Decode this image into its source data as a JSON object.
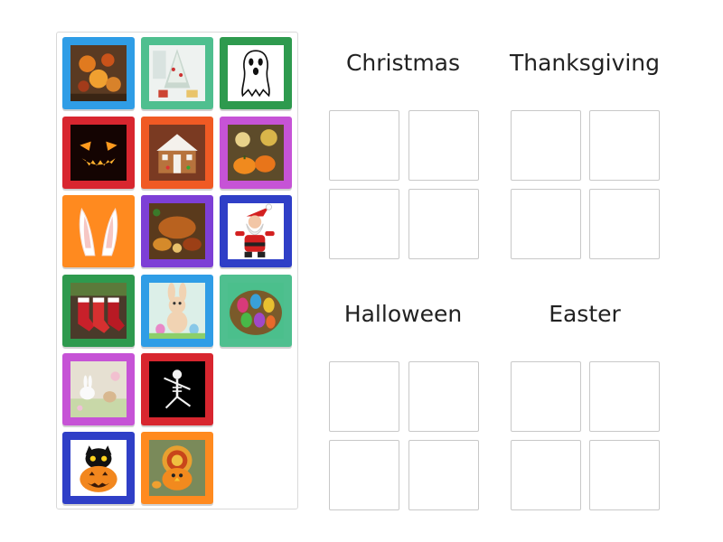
{
  "groups": [
    {
      "title": "Christmas"
    },
    {
      "title": "Thanksgiving"
    },
    {
      "title": "Halloween"
    },
    {
      "title": "Easter"
    }
  ],
  "tiles": [
    {
      "name": "tile-autumn-harvest",
      "frame": "#2f9de6",
      "picture": "harvest-table-icon"
    },
    {
      "name": "tile-christmas-tree-room",
      "frame": "#4fbf8f",
      "picture": "christmas-tree-icon"
    },
    {
      "name": "tile-ghost-drawing",
      "frame": "#2e9a4e",
      "picture": "ghost-icon"
    },
    {
      "name": "tile-jack-o-lantern-face",
      "frame": "#d8262f",
      "picture": "jack-o-lantern-icon"
    },
    {
      "name": "tile-gingerbread-house",
      "frame": "#f05a24",
      "picture": "gingerbread-house-icon"
    },
    {
      "name": "tile-pumpkins-flowers",
      "frame": "#c653d6",
      "picture": "pumpkins-icon"
    },
    {
      "name": "tile-bunny-ears",
      "frame": "#ff8a1f",
      "picture": "bunny-ears-icon"
    },
    {
      "name": "tile-thanksgiving-dinner",
      "frame": "#7d3fd6",
      "picture": "roast-turkey-icon"
    },
    {
      "name": "tile-santa-claus",
      "frame": "#2f3fc7",
      "picture": "santa-icon"
    },
    {
      "name": "tile-christmas-stockings",
      "frame": "#2e9a4e",
      "picture": "stockings-icon"
    },
    {
      "name": "tile-easter-bunny",
      "frame": "#2f9de6",
      "picture": "easter-bunny-icon"
    },
    {
      "name": "tile-easter-eggs",
      "frame": "#4fbf8f",
      "picture": "easter-eggs-icon"
    },
    {
      "name": "tile-easter-bunnies-scene",
      "frame": "#c653d6",
      "picture": "bunnies-scene-icon"
    },
    {
      "name": "tile-skeleton",
      "frame": "#d8262f",
      "picture": "skeleton-icon"
    },
    {
      "name": "tile-black-cat-pumpkin",
      "frame": "#2f3fc7",
      "picture": "black-cat-pumpkin-icon"
    },
    {
      "name": "tile-turkey-pumpkin",
      "frame": "#ff8a1f",
      "picture": "turkey-pumpkin-icon"
    }
  ]
}
